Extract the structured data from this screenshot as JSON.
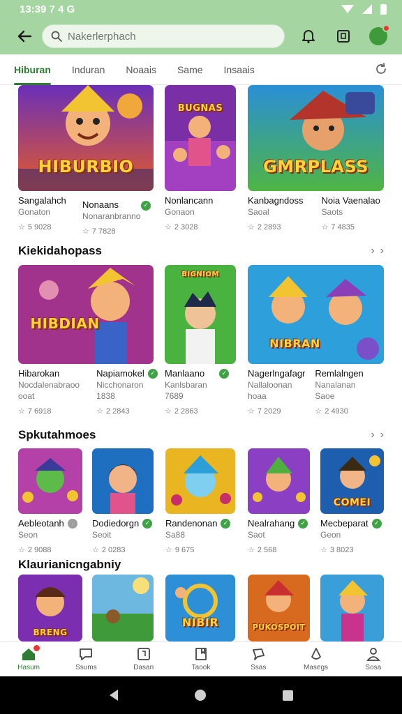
{
  "status_bar": {
    "time": "13:39 7 4 G"
  },
  "search": {
    "placeholder": "Nakerlerphach"
  },
  "tabs": [
    {
      "label": "Hiburan",
      "active": true
    },
    {
      "label": "Induran",
      "active": false
    },
    {
      "label": "Noaais",
      "active": false
    },
    {
      "label": "Same",
      "active": false
    },
    {
      "label": "Insaais",
      "active": false
    }
  ],
  "sections": {
    "featured": {
      "cards": [
        {
          "title": "Sangalahch",
          "sub": "Gonaton",
          "rating": "5 9028",
          "art": "HIBURBIO",
          "badge": ""
        },
        {
          "title": "Nonaans",
          "sub": "Nonaranbranno",
          "rating": "7 7828",
          "badge": "green",
          "art": ""
        },
        {
          "title": "Nonlancann",
          "sub": "Gonaon",
          "rating": "2 3028",
          "art": "BUGNAS",
          "badge": ""
        },
        {
          "title": "Kanbagndoss",
          "sub": "Saoal",
          "rating": "2 2893",
          "art": "GMRPLASS",
          "badge": ""
        },
        {
          "title": "Noia Vaenalao",
          "sub": "Saots",
          "rating": "7 4835",
          "badge": "",
          "art": ""
        }
      ]
    },
    "kids": {
      "title": "Kiekidahopass",
      "cards": [
        {
          "title": "Hibarokan",
          "sub": "Nocdalenabraoo",
          "sub2": "ooat",
          "rating": "7 6918",
          "art": "HIBDIAN",
          "badge": ""
        },
        {
          "title": "Napiamokel",
          "sub": "Nicchonaron",
          "sub2": "1838",
          "rating": "2 2843",
          "badge": "green",
          "art": ""
        },
        {
          "title": "Manlaano",
          "sub": "Kanlsbaran",
          "sub2": "7689",
          "rating": "2 2863",
          "art": "BIGNIOM",
          "badge": "green"
        },
        {
          "title": "Nagerlngafagr",
          "sub": "Nallaloonan",
          "sub2": "hoaa",
          "rating": "7 2029",
          "art": "NIBRAN",
          "badge": ""
        },
        {
          "title": "Remlalngen",
          "sub": "Nanalanan",
          "sub2": "Saoe",
          "rating": "2 4930",
          "badge": "",
          "art": ""
        }
      ]
    },
    "spk": {
      "title": "Spkutahmoes",
      "cards": [
        {
          "title": "Aebleotanh",
          "sub": "Seon",
          "rating": "2 9088",
          "badge": "grey",
          "art": ""
        },
        {
          "title": "Dodiedorgn",
          "sub": "Seoit",
          "rating": "2 0283",
          "badge": "green",
          "art": ""
        },
        {
          "title": "Randenonan",
          "sub": "Sa88",
          "rating": "9 675",
          "badge": "green",
          "art": ""
        },
        {
          "title": "Nealrahang",
          "sub": "Saot",
          "rating": "2 568",
          "badge": "green",
          "art": ""
        },
        {
          "title": "Mecbeparat",
          "sub": "Geon",
          "rating": "3 8023",
          "badge": "green",
          "art": "COMEI"
        }
      ]
    },
    "klaura": {
      "title": "Klaurianicngabniy",
      "cards": [
        {
          "art": "BRENG"
        },
        {
          "art": ""
        },
        {
          "art": "NIBIR"
        },
        {
          "art": "PUKOSPOIT"
        },
        {
          "art": ""
        }
      ]
    }
  },
  "bottom_nav": [
    {
      "label": "Hasum",
      "icon": "home-icon",
      "active": true
    },
    {
      "label": "Ssums",
      "icon": "chat-icon",
      "active": false
    },
    {
      "label": "Dasan",
      "icon": "book-icon",
      "active": false
    },
    {
      "label": "Taook",
      "icon": "bookmark-icon",
      "active": false
    },
    {
      "label": "Ssas",
      "icon": "speech-icon",
      "active": false
    },
    {
      "label": "Masegs",
      "icon": "person-outline-icon",
      "active": false
    },
    {
      "label": "Sosa",
      "icon": "profile-icon",
      "active": false
    }
  ],
  "colors": {
    "accent": "#2e7d32",
    "appbar": "#a5d5a0",
    "badge": "#3fa346",
    "notification": "#e53935"
  }
}
